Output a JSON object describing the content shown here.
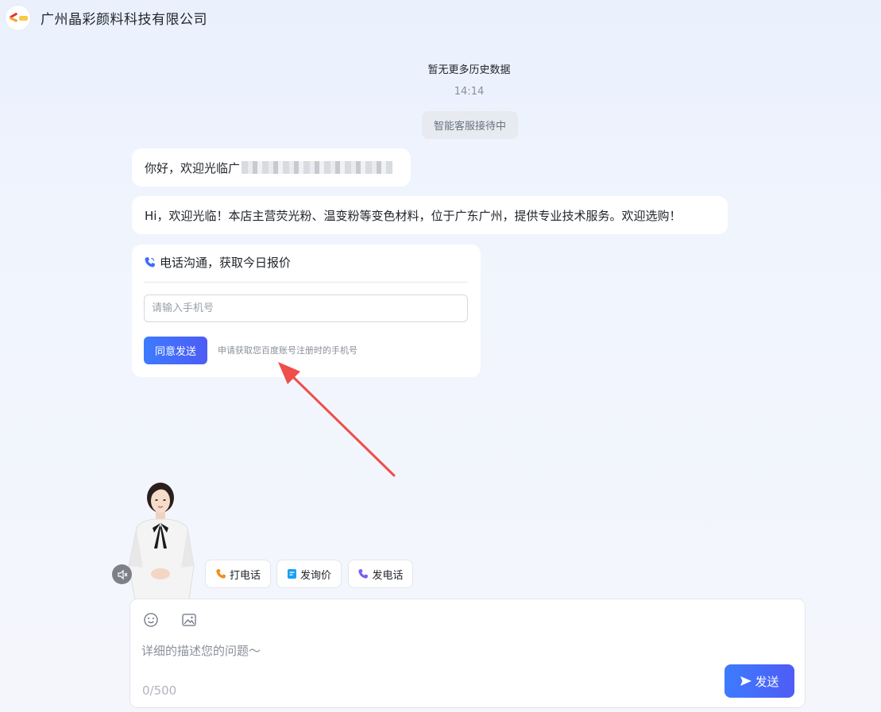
{
  "header": {
    "company_name": "广州晶彩颜料科技有限公司",
    "logo_icon": "company-logo"
  },
  "chat": {
    "no_history": "暂无更多历史数据",
    "timestamp": "14:14",
    "status": "智能客服接待中",
    "messages": [
      {
        "text": "你好，欢迎光临广",
        "has_redaction": true
      },
      {
        "text": "Hi，欢迎光临！本店主营荧光粉、温变粉等变色材料，位于广东广州，提供专业技术服务。欢迎选购！"
      }
    ]
  },
  "phone_card": {
    "title": "电话沟通，获取今日报价",
    "input_placeholder": "请输入手机号",
    "agree_button": "同意发送",
    "hint": "申请获取您百度账号注册时的手机号",
    "accent_color": "#3d6bff"
  },
  "quick_actions": [
    {
      "label": "打电话",
      "icon": "phone-orange-icon",
      "color": "#f28b1a"
    },
    {
      "label": "发询价",
      "icon": "document-icon",
      "color": "#1aa0f2"
    },
    {
      "label": "发电话",
      "icon": "phone-purple-icon",
      "color": "#7a5cf5"
    }
  ],
  "composer": {
    "placeholder": "详细的描述您的问题～",
    "counter": "0/500",
    "send_label": "发送",
    "icons": [
      "emoji-icon",
      "image-icon",
      "send-icon"
    ]
  },
  "annotation": {
    "arrow_color": "#ef4e4a"
  }
}
